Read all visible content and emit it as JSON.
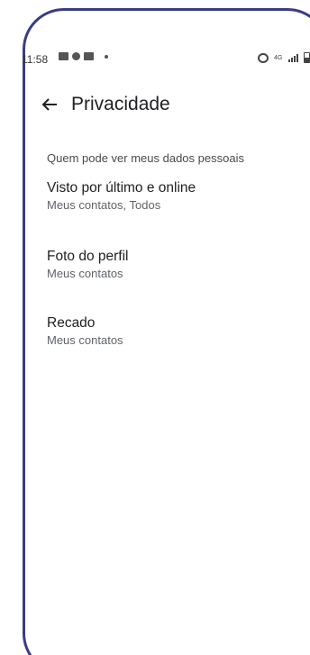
{
  "status_bar": {
    "time": "11:58",
    "network": "4G"
  },
  "header": {
    "title": "Privacidade"
  },
  "section": {
    "header": "Quem pode ver meus dados pessoais",
    "items": [
      {
        "title": "Visto por último e online",
        "subtitle": "Meus contatos, Todos"
      },
      {
        "title": "Foto do perfil",
        "subtitle": "Meus contatos"
      },
      {
        "title": "Recado",
        "subtitle": "Meus contatos"
      }
    ]
  },
  "colors": {
    "frame_border": "#3a3c84",
    "text_primary": "#1f1f1f",
    "text_secondary": "#5f6368"
  },
  "icons": {
    "back": "arrow-back-icon",
    "alarm": "alarm-icon",
    "signal": "signal-icon",
    "battery": "battery-icon"
  }
}
